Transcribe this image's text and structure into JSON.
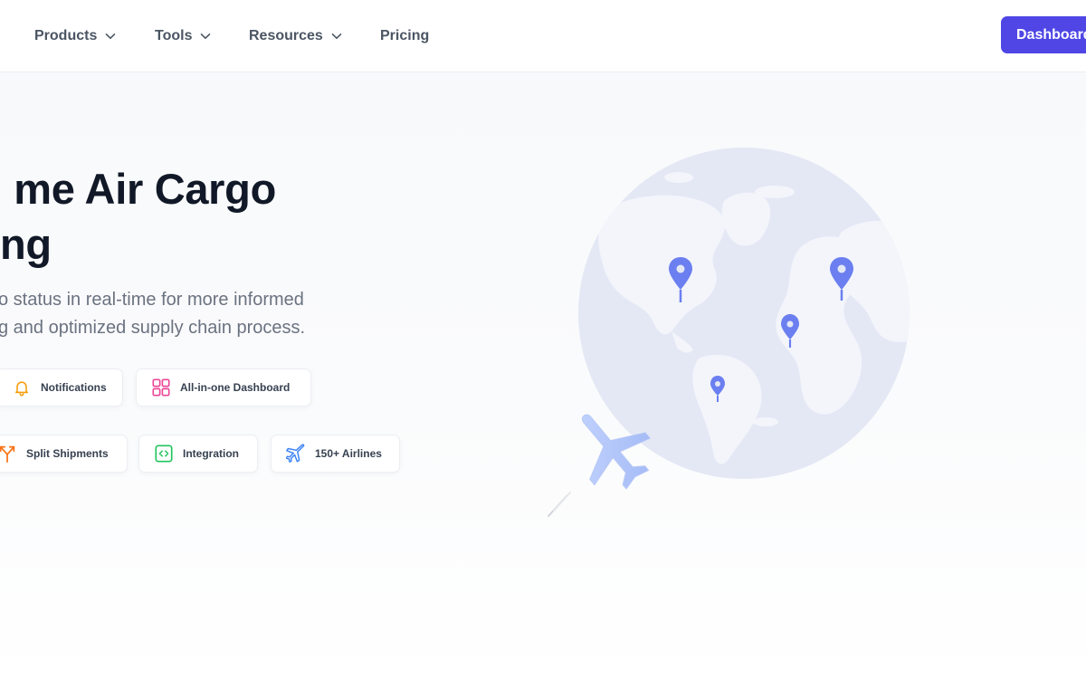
{
  "nav": {
    "items": [
      {
        "label": "Products",
        "has_dropdown": true
      },
      {
        "label": "Tools",
        "has_dropdown": true
      },
      {
        "label": "Resources",
        "has_dropdown": true
      },
      {
        "label": "Pricing",
        "has_dropdown": false
      }
    ],
    "cta_label": "Dashboard"
  },
  "hero": {
    "title_line1": "me Air Cargo",
    "title_line2": "ng",
    "subtitle_line1": "o status in real-time for more informed",
    "subtitle_line2": "g and optimized supply chain process."
  },
  "features": {
    "row1": [
      {
        "label": "Notifications",
        "icon": "bell-icon"
      },
      {
        "label": "All-in-one Dashboard",
        "icon": "grid-icon"
      }
    ],
    "row2": [
      {
        "label": "Split Shipments",
        "icon": "split-arrows-icon"
      },
      {
        "label": "Integration",
        "icon": "code-icon"
      },
      {
        "label": "150+ Airlines",
        "icon": "airplane-icon"
      }
    ]
  },
  "colors": {
    "accent": "#4f46e5",
    "pin": "#6b7ff0",
    "globe": "#e4e8f5",
    "land": "#f3f5fb",
    "bell": "#f59e0b",
    "grid": "#ec4899",
    "split": "#f97316",
    "code": "#22c55e",
    "plane": "#3b82f6"
  }
}
